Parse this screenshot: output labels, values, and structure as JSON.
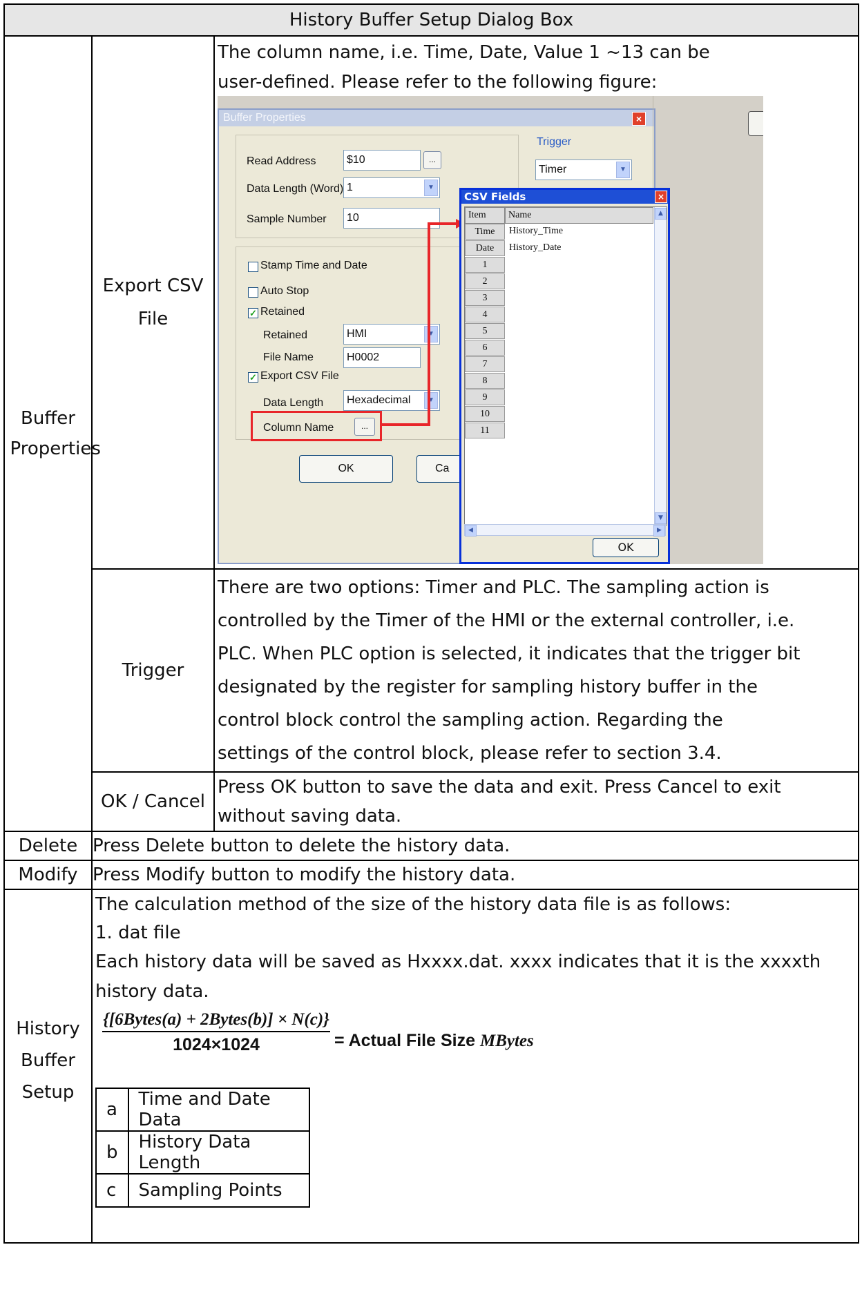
{
  "header": {
    "title": "History Buffer Setup Dialog Box"
  },
  "buffer_properties": {
    "label": "Buffer Properties",
    "export_csv": {
      "label": "Export CSV File",
      "text_line1": "The column name, i.e. Time, Date, Value 1 ~13 can be",
      "text_line2": "user-defined. Please refer to the following figure:"
    },
    "trigger": {
      "label": "Trigger",
      "lines": [
        "There are two options: Timer and PLC. The sampling action is",
        "controlled by the Timer of the HMI or the external controller, i.e.",
        "PLC. When PLC option is selected, it indicates that the trigger bit",
        "designated by the register for sampling history buffer in the",
        "control block control the sampling action. Regarding the",
        "settings of the control block, please refer to section 3.4."
      ]
    },
    "ok_cancel": {
      "label": "OK / Cancel",
      "lines": [
        "Press OK button to save the data and exit. Press Cancel to exit",
        "without saving data."
      ]
    }
  },
  "delete": {
    "label": "Delete",
    "text": "Press Delete button to delete the history data."
  },
  "modify": {
    "label": "Modify",
    "text": "Press Modify button to modify the history data."
  },
  "history_setup": {
    "label_lines": [
      "History",
      "Buffer",
      "Setup"
    ],
    "intro": "The calculation method of the size of the history data file is as follows:",
    "item1": "1.  dat file",
    "desc_line1": "Each history data will be saved as Hxxxx.dat. xxxx indicates that it is the xxxxth",
    "desc_line2": "history data.",
    "formula": {
      "numerator": "{[6Bytes(a) + 2Bytes(b)] × N(c)}",
      "denominator": "1024×1024",
      "result_text": "= Actual File Size",
      "result_unit": "MBytes"
    },
    "legend": [
      {
        "key": "a",
        "desc": "Time and Date Data"
      },
      {
        "key": "b",
        "desc": "History Data Length"
      },
      {
        "key": "c",
        "desc": "Sampling Points"
      }
    ]
  },
  "screenshot": {
    "dialog_title": "Buffer Properties",
    "trigger_label": "Trigger",
    "trigger_value": "Timer",
    "read_address_label": "Read Address",
    "read_address_value": "$10",
    "data_length_word_label": "Data Length (Word)",
    "data_length_word_value": "1",
    "sample_number_label": "Sample Number",
    "sample_number_value": "10",
    "stamp_label": "Stamp Time and Date",
    "auto_stop_label": "Auto Stop",
    "retained_check_label": "Retained",
    "retained_label": "Retained",
    "retained_value": "HMI",
    "file_name_label": "File Name",
    "file_name_value": "H0002",
    "export_csv_label": "Export CSV File",
    "data_length_label": "Data Length",
    "data_length_value": "Hexadecimal",
    "column_name_label": "Column Name",
    "ellipsis": "...",
    "ok_label": "OK",
    "cancel_partial": "Ca",
    "csv_title": "CSV Fields",
    "csv_header_item": "Item",
    "csv_header_name": "Name",
    "csv_rows": [
      {
        "item": "Time",
        "name": "History_Time"
      },
      {
        "item": "Date",
        "name": "History_Date"
      },
      {
        "item": "1",
        "name": ""
      },
      {
        "item": "2",
        "name": ""
      },
      {
        "item": "3",
        "name": ""
      },
      {
        "item": "4",
        "name": ""
      },
      {
        "item": "5",
        "name": ""
      },
      {
        "item": "6",
        "name": ""
      },
      {
        "item": "7",
        "name": ""
      },
      {
        "item": "8",
        "name": ""
      },
      {
        "item": "9",
        "name": ""
      },
      {
        "item": "10",
        "name": ""
      },
      {
        "item": "11",
        "name": ""
      }
    ],
    "csv_ok": "OK",
    "highlight_color": "#e8262a"
  }
}
